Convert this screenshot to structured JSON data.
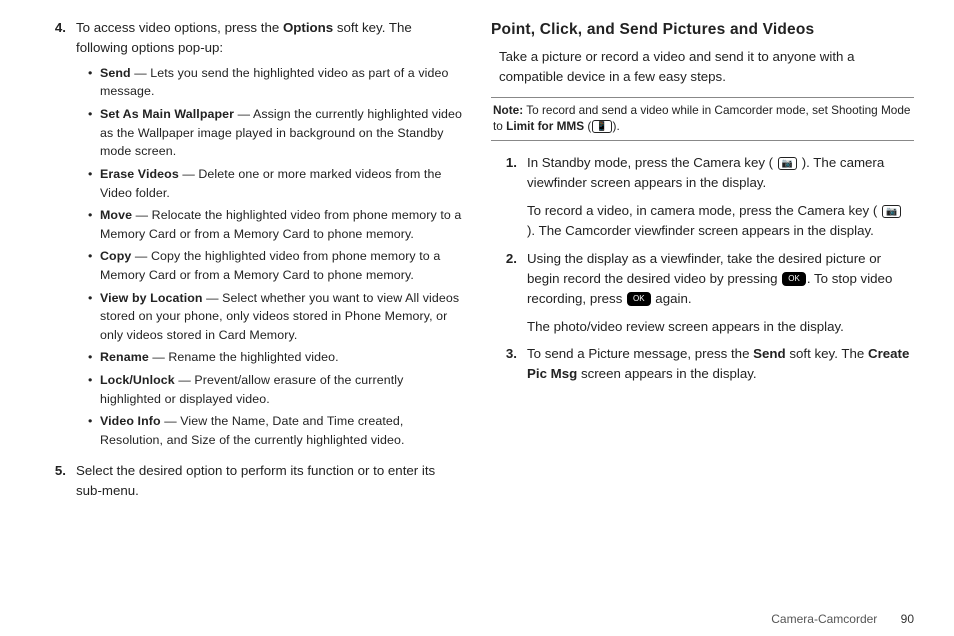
{
  "left": {
    "step4": {
      "num": "4.",
      "text_a": "To access video options, press the ",
      "bold1": "Options",
      "text_b": " soft key. The following options pop-up:"
    },
    "bullets": [
      {
        "name": "Send",
        "desc": " — Lets you send the highlighted video as part of a video message."
      },
      {
        "name": "Set As Main Wallpaper",
        "desc": " — Assign the currently highlighted video as the Wallpaper image played in background on the Standby mode screen."
      },
      {
        "name": "Erase Videos",
        "desc": " — Delete one or more marked videos from the Video folder."
      },
      {
        "name": "Move",
        "desc": " — Relocate the highlighted video from phone memory to a Memory Card or from a Memory Card to phone memory."
      },
      {
        "name": "Copy",
        "desc": " — Copy the highlighted video from phone memory to a Memory Card or from a Memory Card to phone memory."
      },
      {
        "name": "View by Location",
        "desc": " — Select whether you want to view All videos stored on your phone, only videos stored in Phone Memory, or only videos stored in Card Memory."
      },
      {
        "name": "Rename",
        "desc": " — Rename the highlighted video."
      },
      {
        "name": "Lock/Unlock",
        "desc": " — Prevent/allow erasure of the currently highlighted or displayed video."
      },
      {
        "name": "Video Info",
        "desc": " — View the Name, Date and Time created, Resolution, and Size of the currently highlighted video."
      }
    ],
    "step5": {
      "num": "5.",
      "text": "Select the desired option to perform its function or to enter its sub-menu."
    }
  },
  "right": {
    "heading": "Point, Click, and Send Pictures and Videos",
    "intro": "Take a picture or record a video and send it to anyone with a compatible device in a few easy steps.",
    "note_label": "Note:",
    "note_a": " To record and send a video while in Camcorder mode, set Shooting Mode to ",
    "note_b": "Limit for MMS",
    "note_c": " (",
    "note_d": ").",
    "steps": {
      "s1": {
        "num": "1.",
        "a": "In Standby mode, press the Camera key (",
        "b": "). The camera viewfinder screen appears in the display.",
        "c": "To record a video, in camera mode, press the Camera key (",
        "d": "). The Camcorder viewfinder screen appears in the display."
      },
      "s2": {
        "num": "2.",
        "a": "Using the display as a viewfinder, take the desired picture or begin record the desired video by pressing ",
        "b": ". To stop video recording, press ",
        "c": " again.",
        "d": "The photo/video review screen appears in the display."
      },
      "s3": {
        "num": "3.",
        "a": "To send a Picture message, press the ",
        "bold1": "Send",
        "b": " soft key. The ",
        "bold2": "Create Pic Msg",
        "c": " screen appears in the display."
      }
    }
  },
  "footer": {
    "section": "Camera-Camcorder",
    "page": "90"
  },
  "icons": {
    "ok": "OK"
  }
}
